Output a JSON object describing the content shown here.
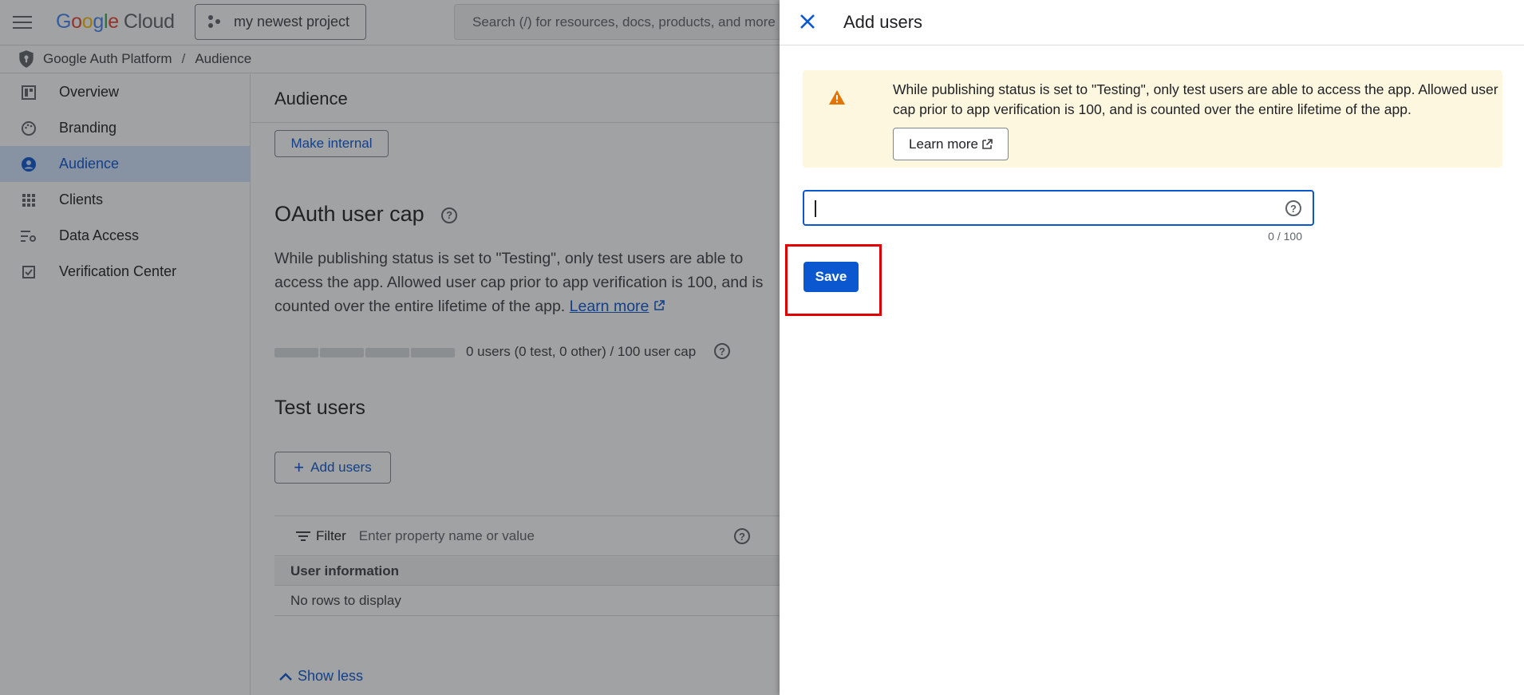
{
  "topbar": {
    "logo": {
      "google": "Google",
      "cloud": "Cloud"
    },
    "project": "my newest project",
    "search_placeholder": "Search (/) for resources, docs, products, and more"
  },
  "breadcrumb": {
    "root": "Google Auth Platform",
    "separator": "/",
    "current": "Audience"
  },
  "sidebar": {
    "items": [
      {
        "label": "Overview",
        "icon": "dashboard-icon"
      },
      {
        "label": "Branding",
        "icon": "palette-icon"
      },
      {
        "label": "Audience",
        "icon": "person-icon",
        "active": true
      },
      {
        "label": "Clients",
        "icon": "grid-icon"
      },
      {
        "label": "Data Access",
        "icon": "tune-icon"
      },
      {
        "label": "Verification Center",
        "icon": "checkbox-icon"
      }
    ]
  },
  "main": {
    "title": "Audience",
    "make_internal": "Make internal",
    "cap_title": "OAuth user cap",
    "cap_description": "While publishing status is set to \"Testing\", only test users are able to access the app. Allowed user cap prior to app verification is 100, and is counted over the entire lifetime of the app.",
    "cap_learn_more": "Learn more",
    "cap_status": "0 users (0 test, 0 other) / 100 user cap",
    "cap_used_fraction": 0,
    "test_users_title": "Test users",
    "add_users": "Add users",
    "filter_label": "Filter",
    "filter_placeholder": "Enter property name or value",
    "table_header": "User information",
    "table_empty": "No rows to display",
    "show_less": "Show less"
  },
  "panel": {
    "title": "Add users",
    "warning_text": "While publishing status is set to \"Testing\", only test users are able to access the app. Allowed user cap prior to app verification is 100, and is counted over the entire lifetime of the app.",
    "learn_more": "Learn more",
    "input_value": "",
    "counter": "0 / 100",
    "save": "Save"
  },
  "colors": {
    "accent": "#0b57d0",
    "warning_bg": "#fef7e0",
    "warning_icon": "#e37400",
    "highlight": "#e00000"
  }
}
